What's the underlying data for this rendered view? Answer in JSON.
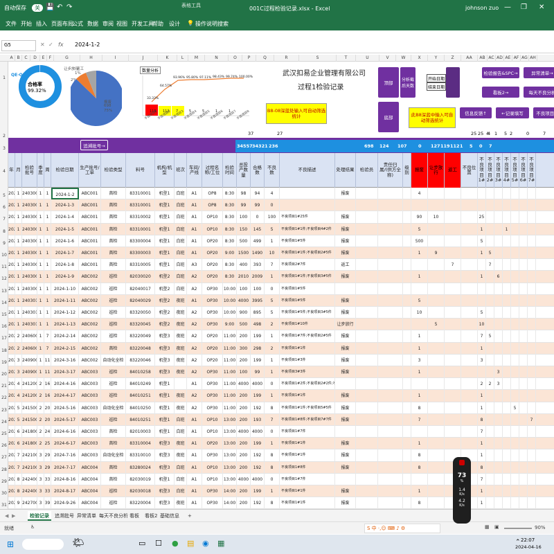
{
  "window": {
    "title": "001C过程检验记录.xlsx - Excel",
    "tool_tab": "表格工具",
    "user": "johnson zuo",
    "save_label": "自动保存",
    "save_state": "关"
  },
  "menu": [
    "文件",
    "开始",
    "插入",
    "页面布局",
    "公式",
    "数据",
    "审阅",
    "视图",
    "开发工具",
    "帮助",
    "设计",
    "操作说明搜索"
  ],
  "formula_bar": {
    "name_box": "G5",
    "fx": "fx",
    "value": "2024-1-2"
  },
  "columns": [
    "A",
    "B",
    "C",
    "D",
    "E",
    "F",
    "G",
    "H",
    "I",
    "J",
    "K",
    "L",
    "M",
    "N",
    "O",
    "P",
    "Q",
    "R",
    "S",
    "T",
    "U",
    "V",
    "W",
    "X",
    "Y",
    "Z",
    "AA",
    "AB",
    "AC",
    "AD",
    "AE",
    "AF",
    "AG",
    "AH"
  ],
  "row_numbers": [
    "1",
    "2",
    "3",
    "4",
    "5",
    "6",
    "7",
    "8",
    "9",
    "10",
    "11",
    "12",
    "13",
    "14",
    "15",
    "16",
    "17",
    "18",
    "19",
    "20",
    "21",
    "22",
    "23",
    "24",
    "25",
    "26",
    "27",
    "28",
    "29",
    "30",
    "31"
  ],
  "dashboard": {
    "logo_text": "QE·QM",
    "ring_label": "合格率",
    "ring_value": "99.32%",
    "ring_percent": 99.32,
    "pie_labels": [
      "让步放行",
      "返工",
      "报废"
    ],
    "pie_values_text": [
      "1%",
      "2%",
      "75%"
    ],
    "pie_count": "698",
    "pareto_filter": "数量分析",
    "pareto_percent_labels": [
      "33.33%",
      "64.57%",
      "93.96%",
      "95.80%",
      "97.11%",
      "98.43%",
      "99.74%",
      "100.00%"
    ],
    "pareto_bar_values": [
      "119",
      "112",
      "7",
      "5",
      "5",
      "1",
      "1"
    ],
    "pareto_x_labels": [
      "不良项目1",
      "不良项目2",
      "不良项目3",
      "不良项目4",
      "不良项目5",
      "不良项目6",
      "不良项目7",
      "不良项目8"
    ],
    "company": "武汉扣易企业管理有限公司",
    "doc_title": "过程1检验记录",
    "callout1": "B8-08深蓝处输入可自动筛选统计",
    "callout2": "此B8深蓝中输入可自动筛选统计",
    "btn_top": "顶部",
    "btn_bottom": "底部",
    "btn_analysis": "分析截后天数",
    "box_start": "开始日期",
    "box_end": "结束日期",
    "btn_report": "检验报告&SPC→",
    "btn_exception": "异常清单→",
    "btn_board": "看板2→",
    "btn_daily": "每天不良分析",
    "btn_feedback": "信息反馈↑",
    "btn_record": "←记录填写",
    "btn_defect": "不良项目↓",
    "btn_trace": "追溯批号→",
    "row2_counts": [
      "37",
      "27"
    ],
    "row2_right": [
      "25",
      "4",
      "2",
      "25",
      "4",
      "1",
      "5",
      "0",
      "7"
    ]
  },
  "bluebar_values": [
    "34557",
    "34321",
    "236",
    "698",
    "124",
    "107",
    "0",
    "127",
    "119",
    "112",
    "1",
    "5",
    "0",
    "7"
  ],
  "headers": [
    "年",
    "月",
    "检验批号",
    "季度",
    "周",
    "检验日期",
    "生产批号/工单",
    "检验类型",
    "料号",
    "机构/机型",
    "班次",
    "车间/产线",
    "过程名称/工位",
    "检验时间",
    "总投产数量",
    "合格数",
    "不良数",
    "不良描述",
    "处理结果",
    "检验员",
    "责任归属/(供方全称)",
    "级别",
    "报废",
    "让步放行",
    "返工",
    "不良位置",
    "不良项目1#",
    "不良项目2#",
    "不良项目3#",
    "不良项目4#",
    "不良项目5#",
    "不良项目6#",
    "不良项目7#"
  ],
  "rows": [
    [
      "2024",
      "1",
      "2403001",
      "1",
      "1",
      "2024-1-2",
      "ABC001",
      "首检",
      "83310001",
      "机型1",
      "白班",
      "A1",
      "OP8",
      "8:30",
      "98",
      "94",
      "4",
      "",
      "报废",
      "",
      "",
      "",
      "4",
      "",
      "",
      "",
      "",
      "",
      "",
      "",
      "",
      "",
      ""
    ],
    [
      "2024",
      "1",
      "2403002",
      "1",
      "1",
      "2024-1-3",
      "ABC001",
      "首检",
      "83310001",
      "机型1",
      "白班",
      "A1",
      "OP8",
      "8:30",
      "99",
      "99",
      "0",
      "",
      "",
      "",
      "",
      "",
      "",
      "",
      "",
      "",
      "",
      "",
      "",
      "",
      "",
      "",
      ""
    ],
    [
      "2024",
      "1",
      "2403003",
      "1",
      "1",
      "2024-1-4",
      "ABC001",
      "首检",
      "83310002",
      "机型1",
      "白班",
      "A1",
      "OP10",
      "8:30",
      "100",
      "0",
      "100",
      "不良项目1#25件",
      "报废",
      "",
      "",
      "",
      "90",
      "10",
      "",
      "",
      "25",
      "",
      "",
      "",
      "",
      "",
      ""
    ],
    [
      "2024",
      "1",
      "2403004",
      "1",
      "1",
      "2024-1-5",
      "ABC001",
      "首检",
      "83310001",
      "机型1",
      "白班",
      "A1",
      "OP10",
      "8:30",
      "150",
      "145",
      "5",
      "不良项目1#1件;不良项目4#2件",
      "报废",
      "",
      "",
      "",
      "5",
      "",
      "",
      "",
      "1",
      "",
      "",
      "1",
      "",
      "",
      ""
    ],
    [
      "2024",
      "1",
      "2403005",
      "1",
      "1",
      "2024-1-6",
      "ABC001",
      "首检",
      "83300004",
      "机型1",
      "白班",
      "A1",
      "OP20",
      "8:30",
      "500",
      "499",
      "1",
      "不良项目1#5件",
      "报废",
      "",
      "",
      "",
      "500",
      "",
      "",
      "",
      "5",
      "",
      "",
      "",
      "",
      "",
      ""
    ],
    [
      "2024",
      "1",
      "2403006",
      "1",
      "1",
      "2024-1-7",
      "ABC001",
      "首检",
      "83300003",
      "机型1",
      "白班",
      "A1",
      "OP20",
      "9:00",
      "1500",
      "1490",
      "10",
      "不良项目1#1件;不良项目2#5件",
      "报废",
      "",
      "",
      "",
      "1",
      "9",
      "",
      "",
      "1",
      "5",
      "",
      "",
      "",
      "",
      ""
    ],
    [
      "2024",
      "1",
      "2403007",
      "1",
      "1",
      "2024-1-8",
      "ABC001",
      "首检",
      "83310005",
      "机型1",
      "白班",
      "A3",
      "OP20",
      "8:30",
      "400",
      "393",
      "7",
      "不良项目2#7件",
      "返工",
      "",
      "",
      "",
      "",
      "",
      "7",
      "",
      "",
      "7",
      "",
      "",
      "",
      "",
      ""
    ],
    [
      "2024",
      "1",
      "2403008",
      "1",
      "1",
      "2024-1-9",
      "ABC002",
      "巡检",
      "82030020",
      "机型2",
      "白班",
      "A2",
      "OP20",
      "8:30",
      "2010",
      "2009",
      "1",
      "不良项目1#1件;不良项目3#5件",
      "报废",
      "",
      "",
      "",
      "1",
      "",
      "",
      "",
      "1",
      "",
      "6",
      "",
      "",
      "",
      ""
    ],
    [
      "2024",
      "1",
      "2403009",
      "1",
      "1",
      "2024-1-10",
      "ABC002",
      "巡检",
      "82040017",
      "机型2",
      "白班",
      "A2",
      "OP30",
      "10:00",
      "100",
      "100",
      "0",
      "不良项目1#5件",
      "",
      "",
      "",
      "",
      "",
      "",
      "",
      "",
      "",
      "",
      "",
      "",
      "",
      "",
      ""
    ],
    [
      "2024",
      "1",
      "2403010",
      "1",
      "1",
      "2024-1-11",
      "ABC002",
      "巡检",
      "82040029",
      "机型2",
      "夜班",
      "A1",
      "OP30",
      "10:00",
      "4000",
      "3995",
      "5",
      "不良项目1#5件",
      "报废",
      "",
      "",
      "",
      "5",
      "",
      "",
      "",
      "",
      "",
      "",
      "",
      "",
      "",
      ""
    ],
    [
      "2024",
      "1",
      "2403011",
      "1",
      "1",
      "2024-1-12",
      "ABC002",
      "巡检",
      "83320050",
      "机型2",
      "夜班",
      "A2",
      "OP30",
      "10:00",
      "900",
      "895",
      "5",
      "不良项目1#5件;不良项目3#5件",
      "报废",
      "",
      "",
      "",
      "10",
      "",
      "",
      "",
      "5",
      "",
      "",
      "",
      "",
      "",
      ""
    ],
    [
      "2024",
      "1",
      "2403012",
      "1",
      "1",
      "2024-1-13",
      "ABC002",
      "巡检",
      "83320045",
      "机型2",
      "夜班",
      "A2",
      "OP30",
      "9:00",
      "500",
      "498",
      "2",
      "不良项目1#10件",
      "让步放行",
      "",
      "",
      "",
      "",
      "5",
      "",
      "",
      "10",
      "",
      "",
      "",
      "",
      "",
      ""
    ],
    [
      "2024",
      "2",
      "2406001",
      "1",
      "7",
      "2024-2-14",
      "ABC002",
      "巡检",
      "83220049",
      "机型3",
      "夜班",
      "A2",
      "OP20",
      "11:00",
      "200",
      "199",
      "1",
      "不良项目1#7件;不良项目2#5件",
      "报废",
      "",
      "",
      "",
      "1",
      "",
      "",
      "",
      "7",
      "5",
      "",
      "",
      "",
      "",
      ""
    ],
    [
      "2024",
      "2",
      "2406002",
      "1",
      "7",
      "2024-2-15",
      "ABC002",
      "首检",
      "83220048",
      "机型3",
      "夜班",
      "A2",
      "OP20",
      "11:00",
      "300",
      "298",
      "2",
      "不良项目1#1件",
      "报废",
      "",
      "",
      "",
      "1",
      "",
      "",
      "",
      "1",
      "",
      "",
      "",
      "",
      "",
      ""
    ],
    [
      "2024",
      "3",
      "2409001",
      "1",
      "11",
      "2024-3-16",
      "ABC002",
      "自动化全检",
      "83220046",
      "机型3",
      "夜班",
      "A2",
      "OP20",
      "11:00",
      "200",
      "199",
      "1",
      "不良项目1#3件",
      "报废",
      "",
      "",
      "",
      "3",
      "",
      "",
      "",
      "3",
      "",
      "",
      "",
      "",
      "",
      ""
    ],
    [
      "2024",
      "3",
      "2409002",
      "1",
      "11",
      "2024-3-17",
      "ABC003",
      "巡检",
      "84010258",
      "机型3",
      "夜班",
      "A2",
      "OP30",
      "11:00",
      "100",
      "99",
      "1",
      "不良项目3#3件",
      "报废",
      "",
      "",
      "",
      "1",
      "",
      "",
      "",
      "",
      "",
      "3",
      "",
      "",
      "",
      ""
    ],
    [
      "2024",
      "4",
      "2412001",
      "2",
      "16",
      "2024-4-16",
      "ABC003",
      "巡检",
      "84010249",
      "机型1",
      "",
      "A1",
      "OP30",
      "11:00",
      "4000",
      "4000",
      "0",
      "不良项目1#2件;不良项目2#2件;不良项目3#3件",
      "",
      "",
      "",
      "",
      "",
      "",
      "",
      "",
      "2",
      "2",
      "3",
      "",
      "",
      "",
      ""
    ],
    [
      "2024",
      "4",
      "2412002",
      "2",
      "16",
      "2024-4-17",
      "ABC003",
      "巡检",
      "84010251",
      "机型1",
      "夜班",
      "A2",
      "OP30",
      "11:00",
      "200",
      "199",
      "1",
      "不良项目1#1件",
      "报废",
      "",
      "",
      "",
      "1",
      "",
      "",
      "",
      "1",
      "",
      "",
      "",
      "",
      "",
      ""
    ],
    [
      "2024",
      "5",
      "2415001",
      "2",
      "20",
      "2024-5-16",
      "ABC003",
      "自动化全检",
      "84010250",
      "机型1",
      "夜班",
      "A2",
      "OP30",
      "11:00",
      "200",
      "192",
      "8",
      "不良项目1#1件;不良项目5#5件",
      "报废",
      "",
      "",
      "",
      "8",
      "",
      "",
      "",
      "1",
      "",
      "",
      "",
      "5",
      "",
      ""
    ],
    [
      "2024",
      "5",
      "2415002",
      "2",
      "20",
      "2024-5-17",
      "ABC003",
      "巡检",
      "84010251",
      "机型1",
      "白班",
      "A1",
      "OP10",
      "13:00",
      "200",
      "193",
      "7",
      "不良项目1#8件;不良项目7#7件",
      "报废",
      "",
      "",
      "",
      "7",
      "",
      "",
      "",
      "8",
      "",
      "",
      "",
      "",
      "",
      "7"
    ],
    [
      "2024",
      "6",
      "2418001",
      "2",
      "24",
      "2024-6-16",
      "ABC003",
      "首检",
      "82010003",
      "机型1",
      "白班",
      "A1",
      "OP10",
      "13:00",
      "4000",
      "4000",
      "0",
      "不良项目1#7件",
      "",
      "",
      "",
      "",
      "",
      "",
      "",
      "",
      "7",
      "",
      "",
      "",
      "",
      "",
      ""
    ],
    [
      "2024",
      "6",
      "2418002",
      "2",
      "25",
      "2024-6-17",
      "ABC003",
      "首检",
      "83310004",
      "机型3",
      "夜班",
      "A1",
      "OP20",
      "13:00",
      "200",
      "199",
      "1",
      "不良项目1#1件",
      "报废",
      "",
      "",
      "",
      "1",
      "",
      "",
      "",
      "1",
      "",
      "",
      "",
      "",
      "",
      ""
    ],
    [
      "2024",
      "7",
      "2421001",
      "3",
      "29",
      "2024-7-16",
      "ABC003",
      "自动化全检",
      "83310010",
      "机型3",
      "夜班",
      "A1",
      "OP30",
      "13:00",
      "200",
      "192",
      "8",
      "不良项目1#1件",
      "报废",
      "",
      "",
      "",
      "8",
      "",
      "",
      "",
      "1",
      "",
      "",
      "",
      "",
      "",
      ""
    ],
    [
      "2024",
      "7",
      "2421002",
      "3",
      "29",
      "2024-7-17",
      "ABC004",
      "首检",
      "83280024",
      "机型3",
      "白班",
      "A1",
      "OP10",
      "13:00",
      "200",
      "192",
      "8",
      "不良项目1#8件",
      "报废",
      "",
      "",
      "",
      "8",
      "",
      "",
      "",
      "8",
      "",
      "",
      "",
      "",
      "",
      ""
    ],
    [
      "2024",
      "8",
      "2424001",
      "3",
      "33",
      "2024-8-16",
      "ABC004",
      "首检",
      "82030019",
      "机型1",
      "白班",
      "A1",
      "OP10",
      "13:00",
      "4000",
      "4000",
      "0",
      "不良项目1#7件",
      "",
      "",
      "",
      "",
      "",
      "",
      "",
      "",
      "7",
      "",
      "",
      "",
      "",
      "",
      ""
    ],
    [
      "2024",
      "8",
      "2424002",
      "3",
      "33",
      "2024-8-17",
      "ABC004",
      "巡检",
      "82030018",
      "机型3",
      "白班",
      "A1",
      "OP30",
      "14:00",
      "200",
      "199",
      "1",
      "不良项目1#1件",
      "报废",
      "",
      "",
      "",
      "1",
      "",
      "",
      "",
      "1",
      "",
      "",
      "",
      "",
      "",
      ""
    ],
    [
      "2024",
      "9",
      "2427001",
      "3",
      "39",
      "2024-9-26",
      "ABC004",
      "巡检",
      "83220004",
      "机型3",
      "夜班",
      "A1",
      "OP30",
      "14:00",
      "200",
      "192",
      "8",
      "不良项目1#1件",
      "报废",
      "",
      "",
      "",
      "8",
      "",
      "",
      "",
      "1",
      "",
      "",
      "",
      "",
      "",
      ""
    ]
  ],
  "sheet_tabs": [
    "检验记录",
    "追溯批号",
    "异常清单",
    "每天不良分析",
    "看板",
    "看板2",
    "基础信息",
    "+"
  ],
  "status": {
    "ready": "就绪",
    "zoom": "90%"
  },
  "perf": {
    "value": "73",
    "unit": "%",
    "up": "1.4",
    "up_unit": "K/s",
    "down": "4.2",
    "down_unit": "K/s"
  },
  "taskbar": {
    "time": "22:07",
    "date": "2024-04-16"
  },
  "colors": {
    "excel_green": "#217346",
    "purple": "#7030a0",
    "blue": "#1e90e0",
    "row_pink": "#fbe5d6",
    "red": "#ff0000"
  }
}
